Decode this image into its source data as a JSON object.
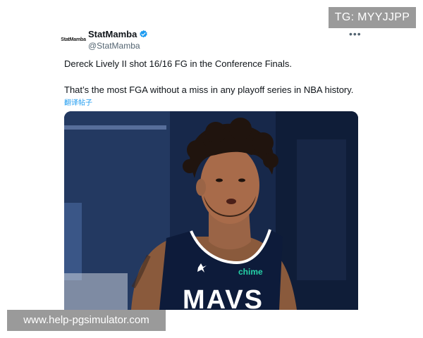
{
  "watermarks": {
    "top": "TG: MYYJJPP",
    "bottom": "www.help-pgsimulator.com"
  },
  "tweet": {
    "avatar_text": "StatMamba",
    "display_name": "StatMamba",
    "handle": "@StatMamba",
    "verified": true,
    "more_icon": "more-horizontal-icon",
    "text_line1": "Dereck Lively II shot 16/16 FG in the Conference Finals.",
    "text_line2": "That’s the most FGA without a miss in any playoff series in NBA history.",
    "translate_link": "翻译帖子",
    "image": {
      "jersey_text": "MAVS",
      "sponsor_text": "chime"
    }
  },
  "colors": {
    "verified_blue": "#1d9bf0",
    "link_blue": "#1d9bf0",
    "jersey_navy": "#0d1b3a",
    "sponsor_green": "#25d3a8"
  }
}
